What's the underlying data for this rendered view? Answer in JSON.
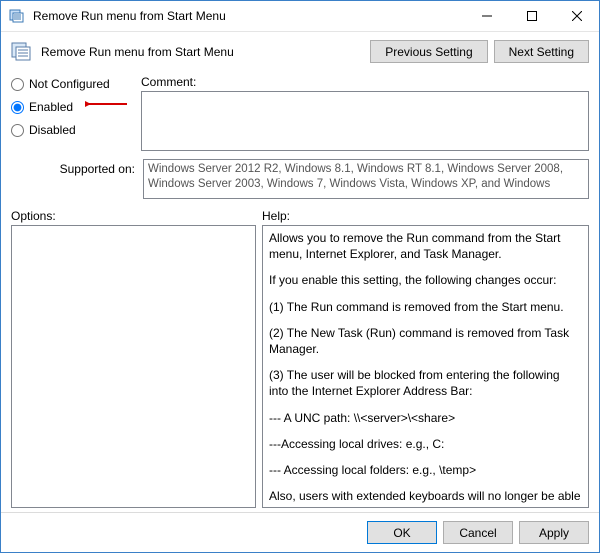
{
  "window": {
    "title": "Remove Run menu from Start Menu"
  },
  "header": {
    "label": "Remove Run menu from Start Menu",
    "prev": "Previous Setting",
    "next": "Next Setting"
  },
  "state": {
    "selected": "enabled",
    "not_configured": "Not Configured",
    "enabled": "Enabled",
    "disabled": "Disabled"
  },
  "comment": {
    "label": "Comment:",
    "value": ""
  },
  "supported": {
    "label": "Supported on:",
    "text": "Windows Server 2012 R2, Windows 8.1, Windows RT 8.1, Windows Server 2008, Windows Server 2003, Windows 7, Windows Vista, Windows XP, and Windows"
  },
  "options": {
    "label": "Options:"
  },
  "help": {
    "label": "Help:",
    "p1": "Allows you to remove the Run command from the Start menu, Internet Explorer, and Task Manager.",
    "p2": "If you enable this setting, the following changes occur:",
    "p3": "(1) The Run command is removed from the Start menu.",
    "p4": "(2) The New Task (Run) command is removed from Task Manager.",
    "p5": "(3) The user will be blocked from entering the following into the Internet Explorer Address Bar:",
    "p6": "--- A UNC path: \\\\<server>\\<share>",
    "p7": "---Accessing local drives:  e.g., C:",
    "p8": "--- Accessing local folders: e.g., \\temp>",
    "p9": "Also, users with extended keyboards will no longer be able to display the Run dialog box by pressing the Application key (the"
  },
  "footer": {
    "ok": "OK",
    "cancel": "Cancel",
    "apply": "Apply"
  }
}
